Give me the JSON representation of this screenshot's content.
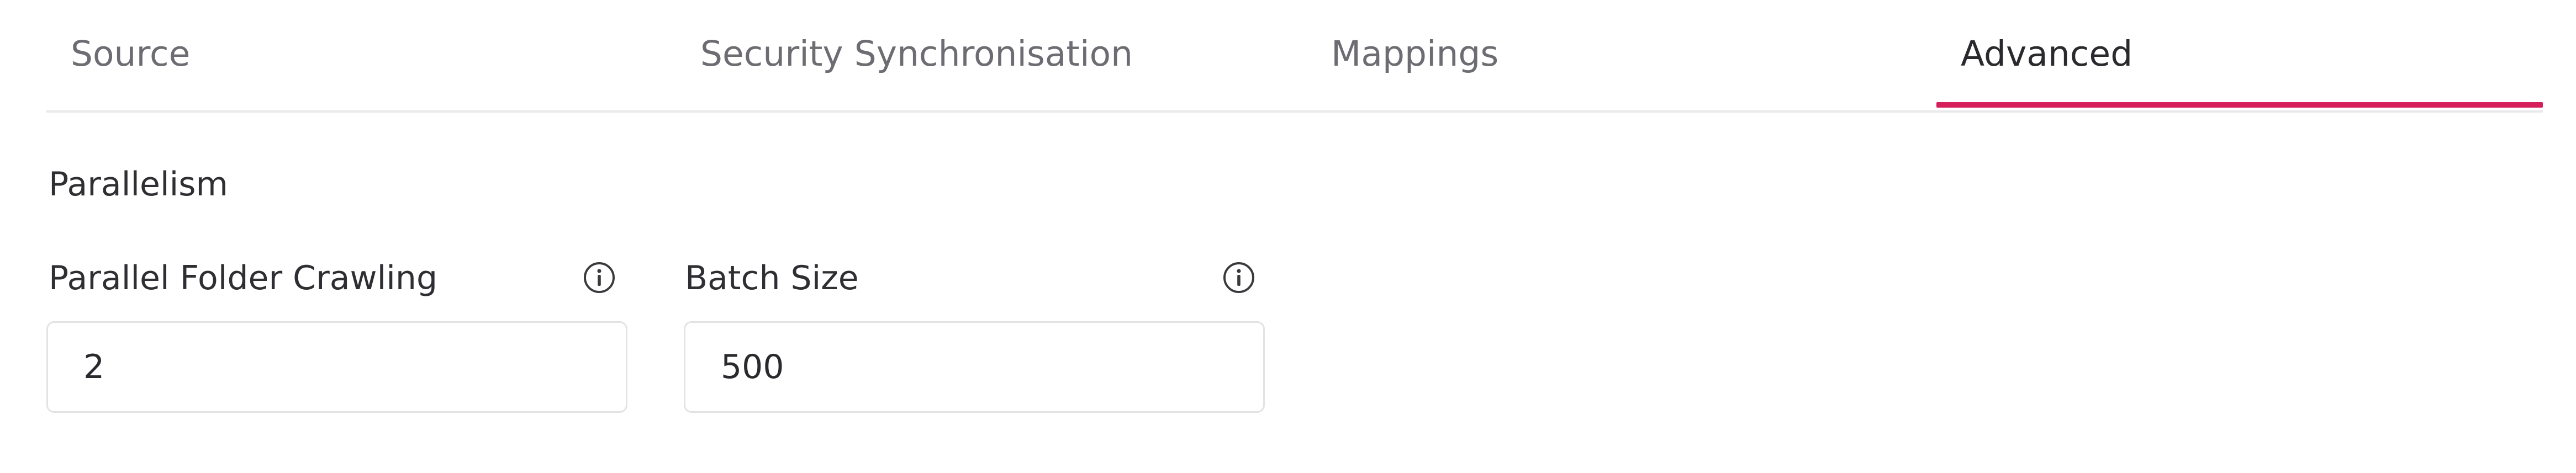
{
  "tabs": [
    {
      "label": "Source",
      "active": false
    },
    {
      "label": "Security Synchronisation",
      "active": false
    },
    {
      "label": "Mappings",
      "active": false
    },
    {
      "label": "Advanced",
      "active": true
    }
  ],
  "accent_color": "#d41f5a",
  "section": {
    "title": "Parallelism"
  },
  "fields": [
    {
      "label": "Parallel Folder Crawling",
      "value": "2",
      "icon": "info-icon"
    },
    {
      "label": "Batch Size",
      "value": "500",
      "icon": "info-icon"
    }
  ]
}
